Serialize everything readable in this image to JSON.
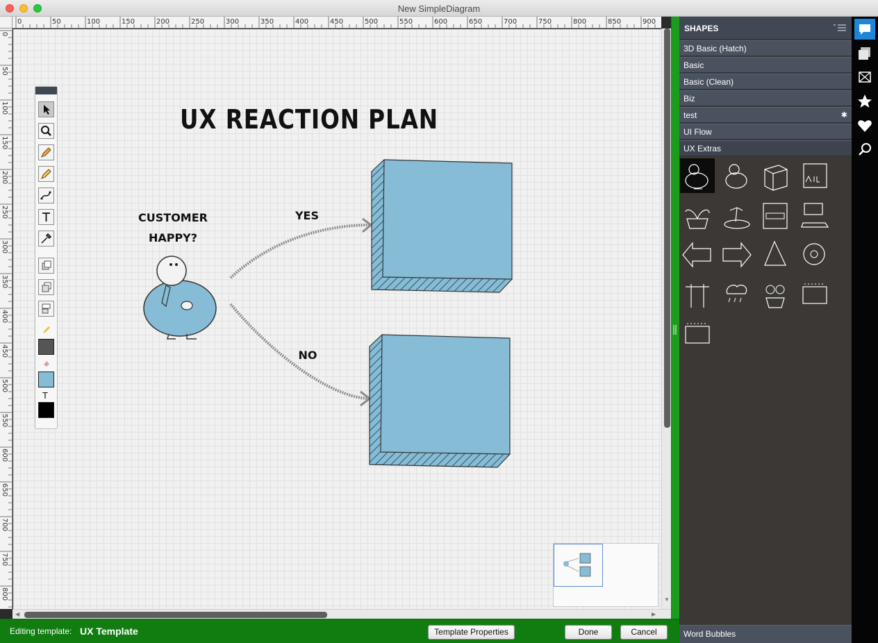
{
  "window": {
    "title": "New SimpleDiagram"
  },
  "ruler": {
    "h_labels": [
      "0",
      "50",
      "100",
      "150",
      "200",
      "250",
      "300",
      "350",
      "400",
      "450",
      "500",
      "550",
      "600",
      "650",
      "700",
      "750",
      "800",
      "850",
      "900"
    ],
    "v_labels": [
      "0",
      "50",
      "100",
      "150",
      "200",
      "250",
      "300",
      "350",
      "400",
      "450",
      "500",
      "550",
      "600",
      "650",
      "700",
      "750",
      "800"
    ]
  },
  "diagram": {
    "title": "UX REACTION PLAN",
    "question_line1": "CUSTOMER",
    "question_line2": "HAPPY?",
    "yes_label": "YES",
    "no_label": "NO",
    "box_color": "#86bcd5"
  },
  "toolbox": {
    "tools": [
      "select-tool",
      "zoom-tool",
      "pencil-tool",
      "marker-tool",
      "connector-tool",
      "text-tool",
      "eyedropper-tool",
      "bring-front-tool",
      "send-back-tool",
      "arrange-tool"
    ],
    "text_glyph": "T",
    "stroke_color": "#555555",
    "fill_color": "#86bcd5",
    "text_color": "#000000"
  },
  "bottom_bar": {
    "editing_label": "Editing template:",
    "template_name": "UX Template",
    "template_properties_button": "Template Properties",
    "done_button": "Done",
    "cancel_button": "Cancel"
  },
  "shapes_panel": {
    "title": "SHAPES",
    "categories": [
      {
        "label": "3D Basic (Hatch)"
      },
      {
        "label": "Basic"
      },
      {
        "label": "Basic (Clean)"
      },
      {
        "label": "Biz"
      },
      {
        "label": "test",
        "marker": "✱"
      },
      {
        "label": "UI Flow"
      },
      {
        "label": "UX Extras"
      }
    ],
    "footer_category": "Word Bubbles",
    "accent_color": "#1c9b1c"
  },
  "side_icons": [
    "comment-icon",
    "pages-icon",
    "image-icon",
    "star-icon",
    "heart-icon",
    "search-icon"
  ]
}
